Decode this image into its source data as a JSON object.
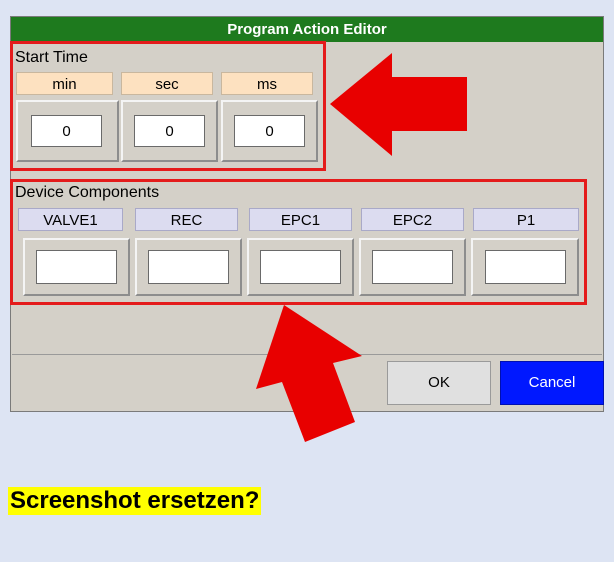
{
  "dialog": {
    "title": "Program Action Editor",
    "start_time": {
      "label": "Start Time",
      "headers": [
        "min",
        "sec",
        "ms"
      ],
      "values": [
        "0",
        "0",
        "0"
      ]
    },
    "device_components": {
      "label": "Device Components",
      "headers": [
        "VALVE1",
        "REC",
        "EPC1",
        "EPC2",
        "P1"
      ],
      "values": [
        "",
        "",
        "",
        "",
        ""
      ]
    },
    "buttons": {
      "ok": "OK",
      "cancel": "Cancel"
    }
  },
  "colors": {
    "titlebar": "#1e7a1e",
    "highlight": "#e41b1b",
    "cancel_button": "#0018ff",
    "note_background": "#ffff00"
  },
  "annotation": {
    "note": "Screenshot ersetzen?"
  }
}
